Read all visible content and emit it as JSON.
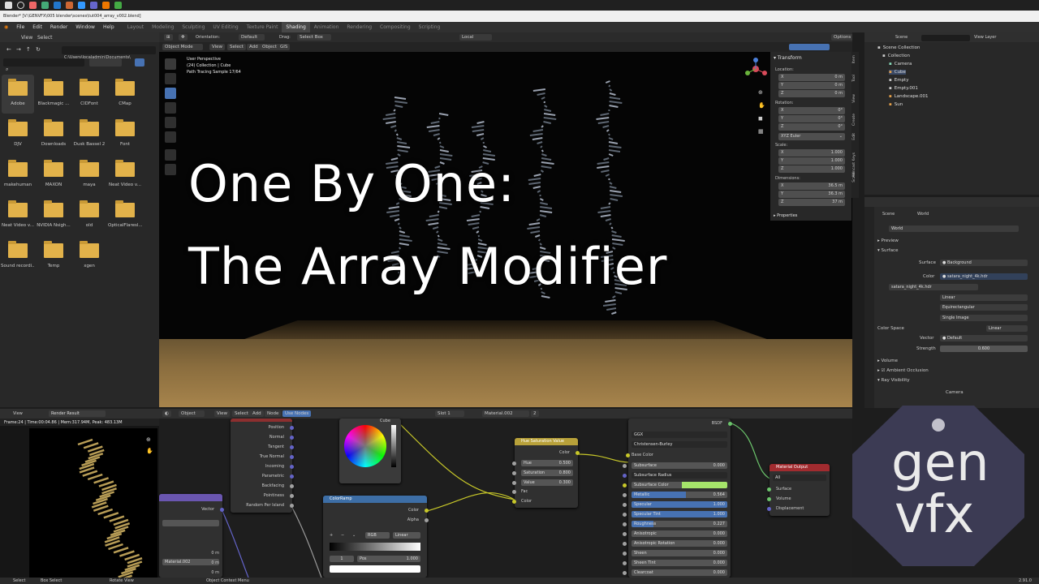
{
  "window": {
    "title": "Blender* [V:\\GENVFX\\005 blender\\scenes\\tut004_array_v002.blend]"
  },
  "menubar": {
    "menus": [
      "File",
      "Edit",
      "Render",
      "Window",
      "Help"
    ],
    "workspaces": [
      "Layout",
      "Modeling",
      "Sculpting",
      "UV Editing",
      "Texture Paint",
      "Shading",
      "Animation",
      "Rendering",
      "Compositing",
      "Scripting"
    ],
    "active_workspace": "Shading"
  },
  "filebrowser": {
    "header": [
      "View",
      "Select"
    ],
    "path": "C:\\Users\\localadmin\\Documents\\",
    "folders": [
      "Adobe",
      "Blackmagic ...",
      "CIDFont",
      "CMap",
      "DJV",
      "Downloads",
      "Dusk Bassel 2",
      "Font",
      "makehuman",
      "MAXON",
      "maya",
      "Neat Video v...",
      "Neat Video v...",
      "NVIDIA Nsigh...",
      "old",
      "OpticalFlaresl...",
      "Sound recordi...",
      "Temp",
      "xgen"
    ]
  },
  "viewport": {
    "mode": "Object Mode",
    "header_menus": [
      "View",
      "Select",
      "Add",
      "Object",
      "GIS"
    ],
    "orientation_label": "Orientation:",
    "orientation_value": "Default",
    "drag_label": "Drag:",
    "drag_value": "Select Box",
    "transform_space": "Local",
    "options": "Options",
    "overlay_lines": [
      "User Perspective",
      "(24) Collection | Cube",
      "Path Tracing Sample 17/64"
    ],
    "title_line1": "One By One:",
    "title_line2": "The Array Modifier"
  },
  "npanel": {
    "header": "Transform",
    "location_label": "Location:",
    "location": [
      [
        "X",
        "0 m"
      ],
      [
        "Y",
        "0 m"
      ],
      [
        "Z",
        "0 m"
      ]
    ],
    "rotation_label": "Rotation:",
    "rotation": [
      [
        "X",
        "0°"
      ],
      [
        "Y",
        "0°"
      ],
      [
        "Z",
        "0°"
      ]
    ],
    "rotation_mode": "XYZ Euler",
    "scale_label": "Scale:",
    "scale": [
      [
        "X",
        "1.000"
      ],
      [
        "Y",
        "1.000"
      ],
      [
        "Z",
        "1.000"
      ]
    ],
    "dimensions_label": "Dimensions:",
    "dimensions": [
      [
        "X",
        "36.5 m"
      ],
      [
        "Y",
        "36.3 m"
      ],
      [
        "Z",
        "37 m"
      ]
    ],
    "properties": "Properties",
    "tabs": [
      "Item",
      "Tool",
      "View",
      "Create",
      "Edit",
      "Screencast Keys",
      "AN"
    ]
  },
  "outliner": {
    "header": "Scene",
    "view_layer": "View Layer",
    "items": [
      "Scene Collection",
      "Collection",
      "Camera",
      "Cube",
      "Empty",
      "Empty.001",
      "Landscape.001",
      "Sun"
    ]
  },
  "properties": {
    "scene": "Scene",
    "world_tab": "World",
    "world_name": "World",
    "preview": "Preview",
    "surface": "Surface",
    "surface_label": "Surface",
    "surface_value": "Background",
    "color_label": "Color",
    "color_value": "satara_night_4k.hdr",
    "image_name": "satara_night_4k.hdr",
    "interp": "Linear",
    "projection": "Equirectangular",
    "source": "Single Image",
    "colorspace_label": "Color Space",
    "colorspace_value": "Linear",
    "vector_label": "Vector",
    "vector_value": "Default",
    "strength_label": "Strength",
    "strength_value": "0.600",
    "volume": "Volume",
    "ao": "Ambient Occlusion",
    "ray_visibility": "Ray Visibility",
    "camera": "Camera"
  },
  "image_editor": {
    "view": "View",
    "image": "Render Result",
    "info": "Frame:24 | Time:00:04.86 | Mem:317.94M, Peak: 483.13M"
  },
  "node_editor": {
    "mode": "Object",
    "menus": [
      "View",
      "Select",
      "Add",
      "Node"
    ],
    "use_nodes": "Use Nodes",
    "slot": "Slot 1",
    "material": "Material.002",
    "users": "2",
    "geometry_outputs": [
      "Position",
      "Normal",
      "Tangent",
      "True Normal",
      "Incoming",
      "Parametric",
      "Backfacing",
      "Pointiness",
      "Random Per Island"
    ],
    "vector_label": "Vector",
    "material_name": "Material.002",
    "mini_values": [
      "0 m",
      "0 m",
      "0 m"
    ],
    "cube_label": "Cube",
    "colorramp": {
      "title": "ColorRamp",
      "outputs": [
        "Color",
        "Alpha"
      ],
      "mode": "RGB",
      "interp": "Linear",
      "stop": "1",
      "pos_label": "Pos",
      "pos_value": "1.000",
      "buttons": [
        "+",
        "−",
        "⌄"
      ]
    },
    "hsv": {
      "title": "Hue Saturation Value",
      "out": "Color",
      "fields": [
        [
          "Hue",
          "0.500"
        ],
        [
          "Saturation",
          "0.800"
        ],
        [
          "Value",
          "0.300"
        ]
      ],
      "inputs": [
        "Fac",
        "Color"
      ]
    },
    "bsdf": {
      "out": "BSDF",
      "distribution": "GGX",
      "sss_method": "Christensen-Burley",
      "base_color": "Base Color",
      "rows": [
        [
          "Subsurface",
          "0.000"
        ],
        [
          "Subsurface Radius",
          ""
        ],
        [
          "Subsurface Color",
          ""
        ],
        [
          "Metallic",
          "0.564"
        ],
        [
          "Specular",
          "1.000"
        ],
        [
          "Specular Tint",
          "1.000"
        ],
        [
          "Roughness",
          "0.227"
        ],
        [
          "Anisotropic",
          "0.000"
        ],
        [
          "Anisotropic Rotation",
          "0.000"
        ],
        [
          "Sheen",
          "0.000"
        ],
        [
          "Sheen Tint",
          "0.000"
        ],
        [
          "Clearcoat",
          "0.000"
        ]
      ]
    },
    "output": {
      "title": "Material Output",
      "target": "All",
      "inputs": [
        "Surface",
        "Volume",
        "Displacement"
      ]
    }
  },
  "statusbar": {
    "items": [
      "Select",
      "Box Select",
      "Rotate View",
      "Object Context Menu"
    ],
    "version": "2.91.0"
  },
  "logo": {
    "line1": "gen",
    "line2": "vfx"
  },
  "colors": {
    "accent_blue": "#4772b3",
    "folder": "#e2b24a",
    "hsv_header": "#b8a13a",
    "colorramp_header": "#3d6ea6",
    "output_header": "#a12b2f",
    "logo_bg": "#3c3b54"
  }
}
